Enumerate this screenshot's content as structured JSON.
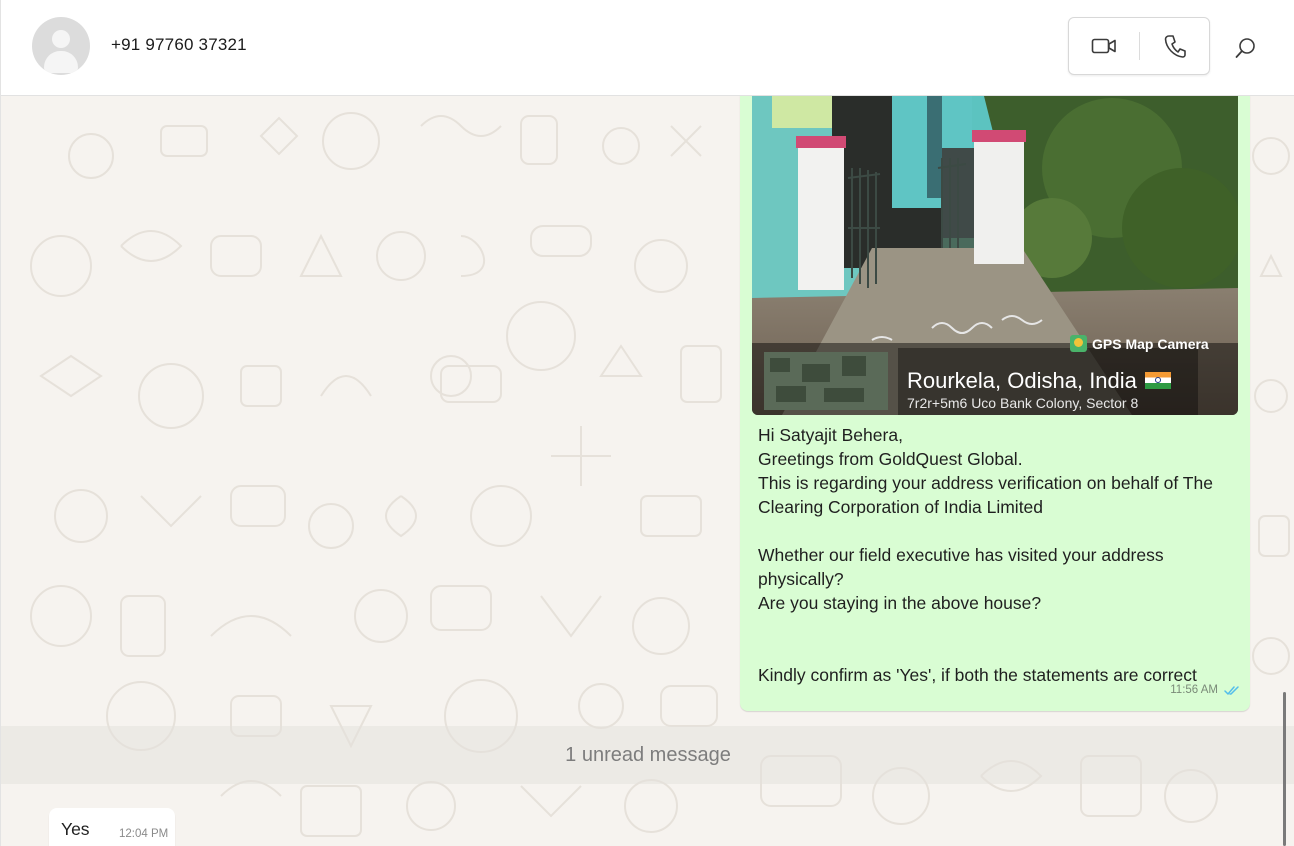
{
  "header": {
    "contact_name": "+91 97760 37321",
    "avatar_icon": "default-user-avatar",
    "video_call_icon": "video-camera-icon",
    "voice_call_icon": "phone-icon",
    "search_icon": "search-icon"
  },
  "messages": {
    "outgoing": {
      "photo": {
        "watermark": "GPS Map Camera",
        "location": "Rourkela, Odisha, India",
        "address": "7r2r+5m6 Uco Bank Colony, Sector 8"
      },
      "lines": [
        "Hi Satyajit Behera,",
        "Greetings from GoldQuest Global.",
        "This is regarding your address verification on behalf of The",
        "Clearing Corporation of India Limited",
        "",
        "Whether our field executive has visited your address",
        "physically?",
        "Are you staying in the above house?",
        "",
        "",
        "Kindly confirm as 'Yes', if both the statements are correct"
      ],
      "time": "11:56 AM",
      "status_icon": "double-check-read-icon"
    },
    "unread_divider": "1 unread message",
    "incoming": {
      "text": "Yes",
      "time": "12:04 PM"
    }
  },
  "colors": {
    "outgoing_bubble": "#d9fdd3",
    "incoming_bubble": "#ffffff",
    "chat_background": "#f6f3ef",
    "read_tick": "#53bdeb"
  }
}
